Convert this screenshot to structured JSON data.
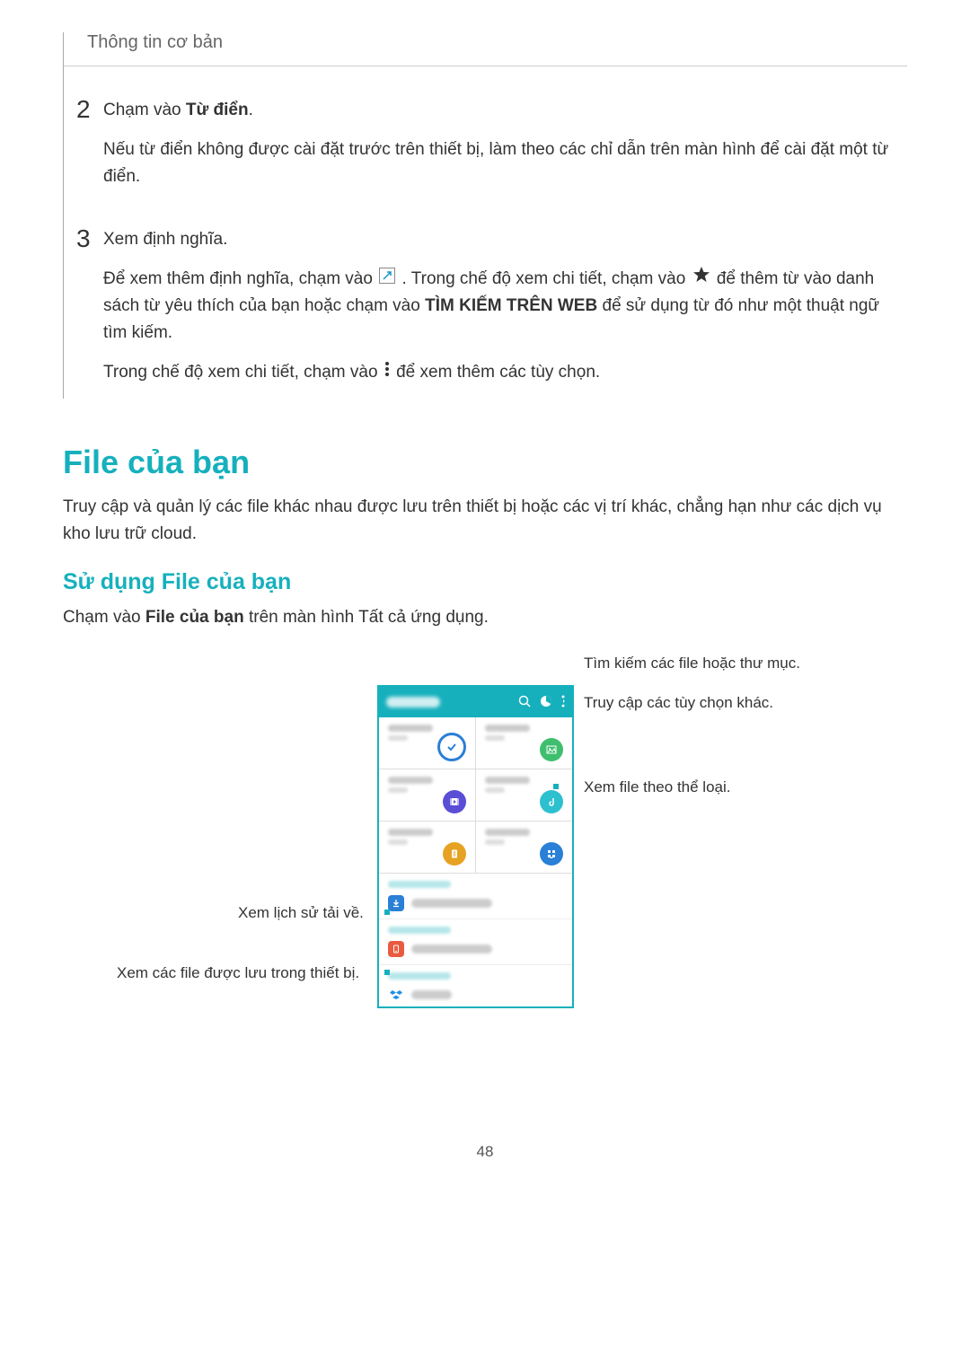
{
  "header": {
    "breadcrumb": "Thông tin cơ bản"
  },
  "steps": [
    {
      "num": "2",
      "line1_pre": "Chạm vào ",
      "line1_bold": "Từ điển",
      "line1_post": ".",
      "para2": "Nếu từ điển không được cài đặt trước trên thiết bị, làm theo các chỉ dẫn trên màn hình để cài đặt một từ điển."
    },
    {
      "num": "3",
      "line1": "Xem định nghĩa.",
      "para2_a": "Để xem thêm định nghĩa, chạm vào ",
      "para2_b": ". Trong chế độ xem chi tiết, chạm vào ",
      "para2_c": " để thêm từ vào danh sách từ yêu thích của bạn hoặc chạm vào ",
      "para2_bold": "TÌM KIẾM TRÊN WEB",
      "para2_d": " để sử dụng từ đó như một thuật ngữ tìm kiếm.",
      "para3_a": "Trong chế độ xem chi tiết, chạm vào ",
      "para3_b": " để xem thêm các tùy chọn."
    }
  ],
  "section": {
    "title": "File của bạn",
    "desc": "Truy cập và quản lý các file khác nhau được lưu trên thiết bị hoặc các vị trí khác, chẳng hạn như các dịch vụ kho lưu trữ cloud."
  },
  "subsection": {
    "title": "Sử dụng File của bạn",
    "desc_pre": "Chạm vào ",
    "desc_bold": "File của bạn",
    "desc_post": " trên màn hình Tất cả ứng dụng."
  },
  "callouts": {
    "search": "Tìm kiếm các file hoặc thư mục.",
    "options": "Truy cập các tùy chọn khác.",
    "category": "Xem file theo thể loại.",
    "download": "Xem lịch sử tải về.",
    "device": "Xem các file được lưu trong thiết bị."
  },
  "pageNumber": "48"
}
